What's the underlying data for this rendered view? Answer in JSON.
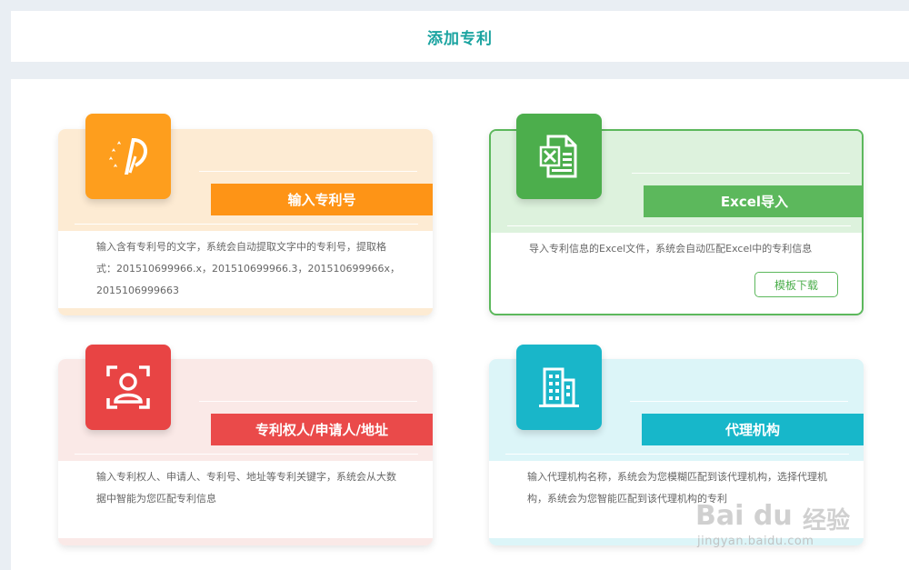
{
  "header": {
    "title": "添加专利"
  },
  "cards": [
    {
      "label": "输入专利号",
      "desc": "输入含有专利号的文字，系统会自动提取文字中的专利号，提取格式：201510699966.x，201510699966.3，201510699966x，2015106999663",
      "icon": "patent-logo-icon",
      "colors": {
        "band": "#fdebd3",
        "accent": "#fe9416",
        "icon": "#fe9e1d"
      }
    },
    {
      "label": "Excel导入",
      "desc": "导入专利信息的Excel文件，系统会自动匹配Excel中的专利信息",
      "button": "模板下载",
      "icon": "excel-file-icon",
      "colors": {
        "band": "#ddf2dd",
        "accent": "#5cb85c",
        "icon": "#4cae4c"
      }
    },
    {
      "label": "专利权人/申请人/地址",
      "desc": "输入专利权人、申请人、专利号、地址等专利关键字，系统会从大数据中智能为您匹配专利信息",
      "icon": "person-scan-icon",
      "colors": {
        "band": "#fae9e7",
        "accent": "#ea4a4a",
        "icon": "#e84444"
      }
    },
    {
      "label": "代理机构",
      "desc": "输入代理机构名称，系统会为您模糊匹配到该代理机构，选择代理机构，系统会为您智能匹配到该代理机构的专利",
      "icon": "building-icon",
      "colors": {
        "band": "#dcf5f8",
        "accent": "#17b7ca",
        "icon": "#19b6c9"
      }
    }
  ],
  "watermark": {
    "brand": "Bai du",
    "product": "经验",
    "url": "jingyan.baidu.com"
  }
}
